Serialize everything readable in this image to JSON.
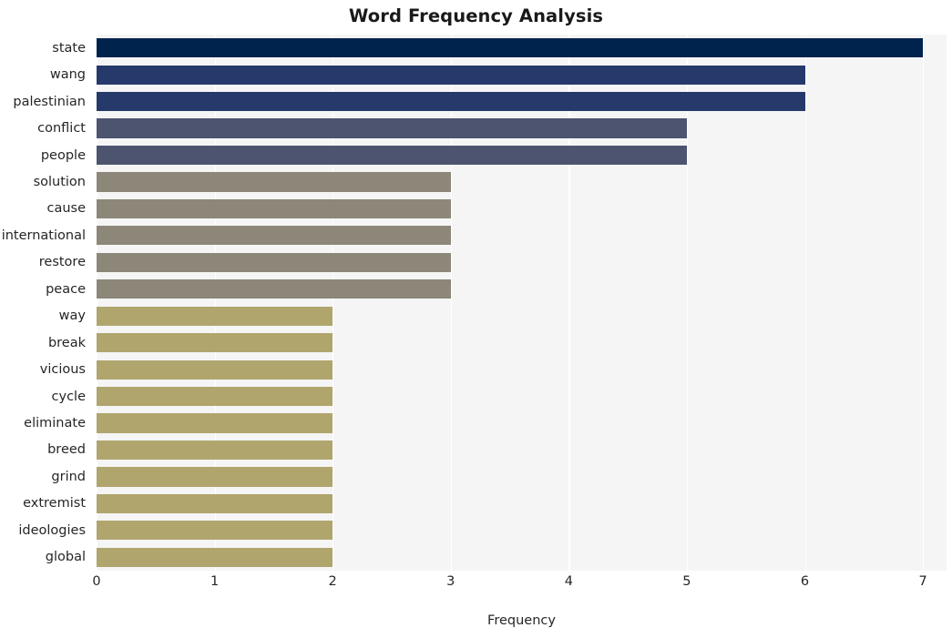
{
  "chart_data": {
    "type": "bar",
    "orientation": "horizontal",
    "title": "Word Frequency Analysis",
    "xlabel": "Frequency",
    "ylabel": "",
    "xlim": [
      0,
      7.2
    ],
    "xticks": [
      "0",
      "1",
      "2",
      "3",
      "4",
      "5",
      "6",
      "7"
    ],
    "xtick_values": [
      0,
      1,
      2,
      3,
      4,
      5,
      6,
      7
    ],
    "grid": "vertical-white-on-light-gray",
    "legend": "none",
    "categories": [
      "state",
      "wang",
      "palestinian",
      "conflict",
      "people",
      "solution",
      "cause",
      "international",
      "restore",
      "peace",
      "way",
      "break",
      "vicious",
      "cycle",
      "eliminate",
      "breed",
      "grind",
      "extremist",
      "ideologies",
      "global"
    ],
    "values": [
      7,
      6,
      6,
      5,
      5,
      3,
      3,
      3,
      3,
      3,
      2,
      2,
      2,
      2,
      2,
      2,
      2,
      2,
      2,
      2
    ],
    "bar_colors": [
      "#00234d",
      "#25396b",
      "#25396b",
      "#4d5470",
      "#4d5470",
      "#8d8779",
      "#8d8779",
      "#8d8779",
      "#8d8779",
      "#8d8779",
      "#b0a56d",
      "#b0a56d",
      "#b0a56d",
      "#b0a56d",
      "#b0a56d",
      "#b0a56d",
      "#b0a56d",
      "#b0a56d",
      "#b0a56d",
      "#b0a56d"
    ],
    "plot_background": "#f5f5f6",
    "figure_background": "#ffffff",
    "gridline_color": "#ffffff"
  }
}
